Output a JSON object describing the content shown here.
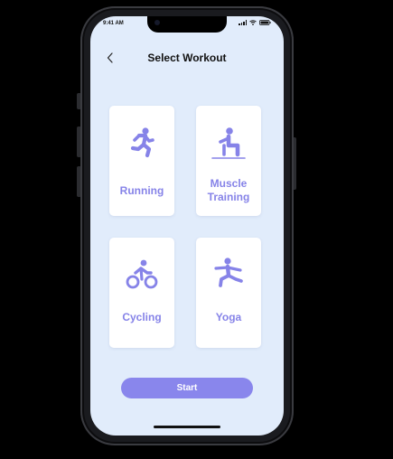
{
  "status_bar": {
    "time": "9:41 AM"
  },
  "header": {
    "title": "Select Workout",
    "back_icon": "chevron-left-icon"
  },
  "workouts": [
    {
      "label": "Running",
      "icon": "running-person-icon"
    },
    {
      "label": "Muscle Training",
      "icon": "squat-person-icon"
    },
    {
      "label": "Cycling",
      "icon": "cyclist-icon"
    },
    {
      "label": "Yoga",
      "icon": "yoga-pose-icon"
    }
  ],
  "start_button": {
    "label": "Start"
  },
  "colors": {
    "screen_background": "#e1ecfb",
    "accent": "#8683e8",
    "button": "#8986ec",
    "card": "#ffffff"
  }
}
